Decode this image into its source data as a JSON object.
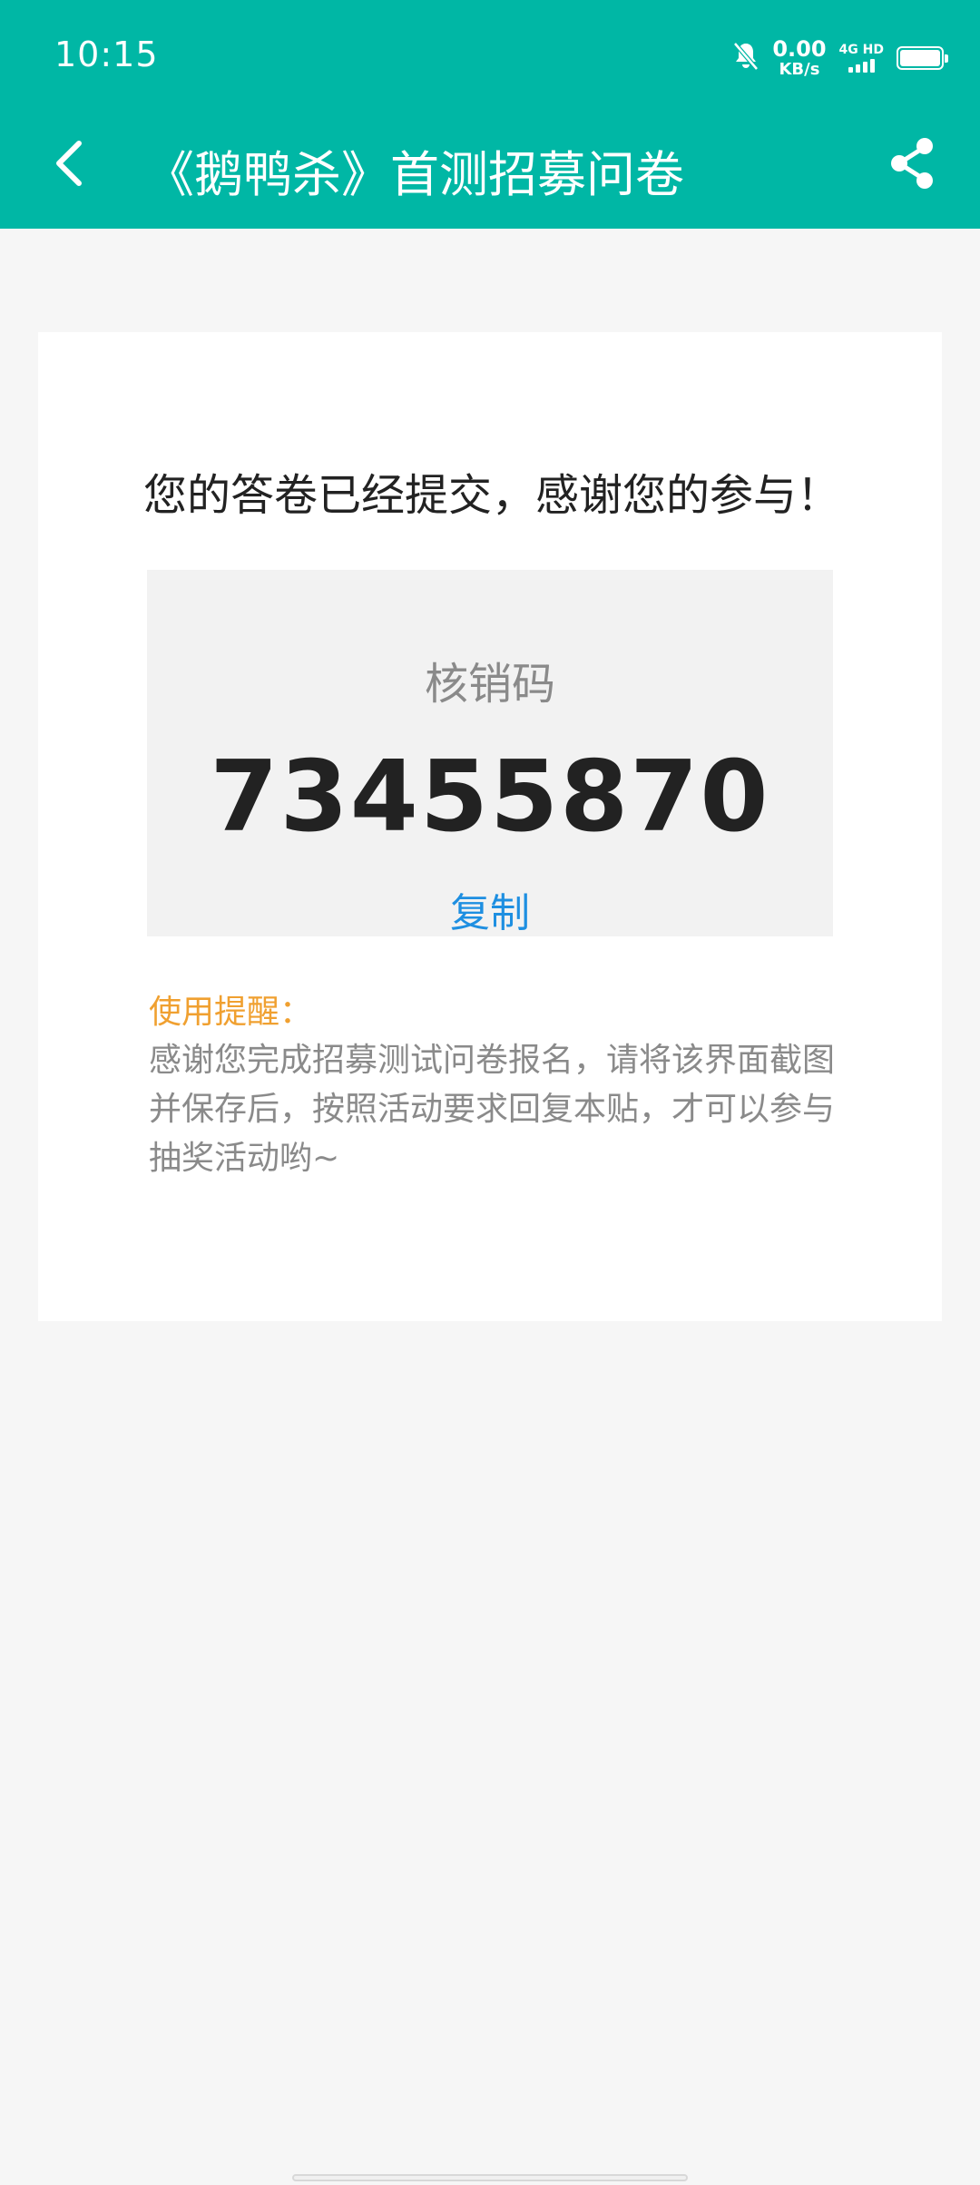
{
  "status_bar": {
    "time": "10:15",
    "net_speed_value": "0.00",
    "net_speed_unit": "KB/s",
    "network_label": "4G HD"
  },
  "header": {
    "title": "《鹅鸭杀》首测招募问卷",
    "back_icon": "chevron-left-icon",
    "share_icon": "share-icon",
    "bg_color": "#00b7a5"
  },
  "card": {
    "success_message": "您的答卷已经提交，感谢您的参与！",
    "code_label": "核销码",
    "code_value": "73455870",
    "copy_label": "复制",
    "tip_title": "使用提醒：",
    "tip_text": "感谢您完成招募测试问卷报名，请将该界面截图并保存后，按照活动要求回复本贴，才可以参与抽奖活动哟~"
  },
  "colors": {
    "accent": "#00b7a5",
    "link": "#1e8fe1",
    "tip_title": "#f0a030"
  }
}
